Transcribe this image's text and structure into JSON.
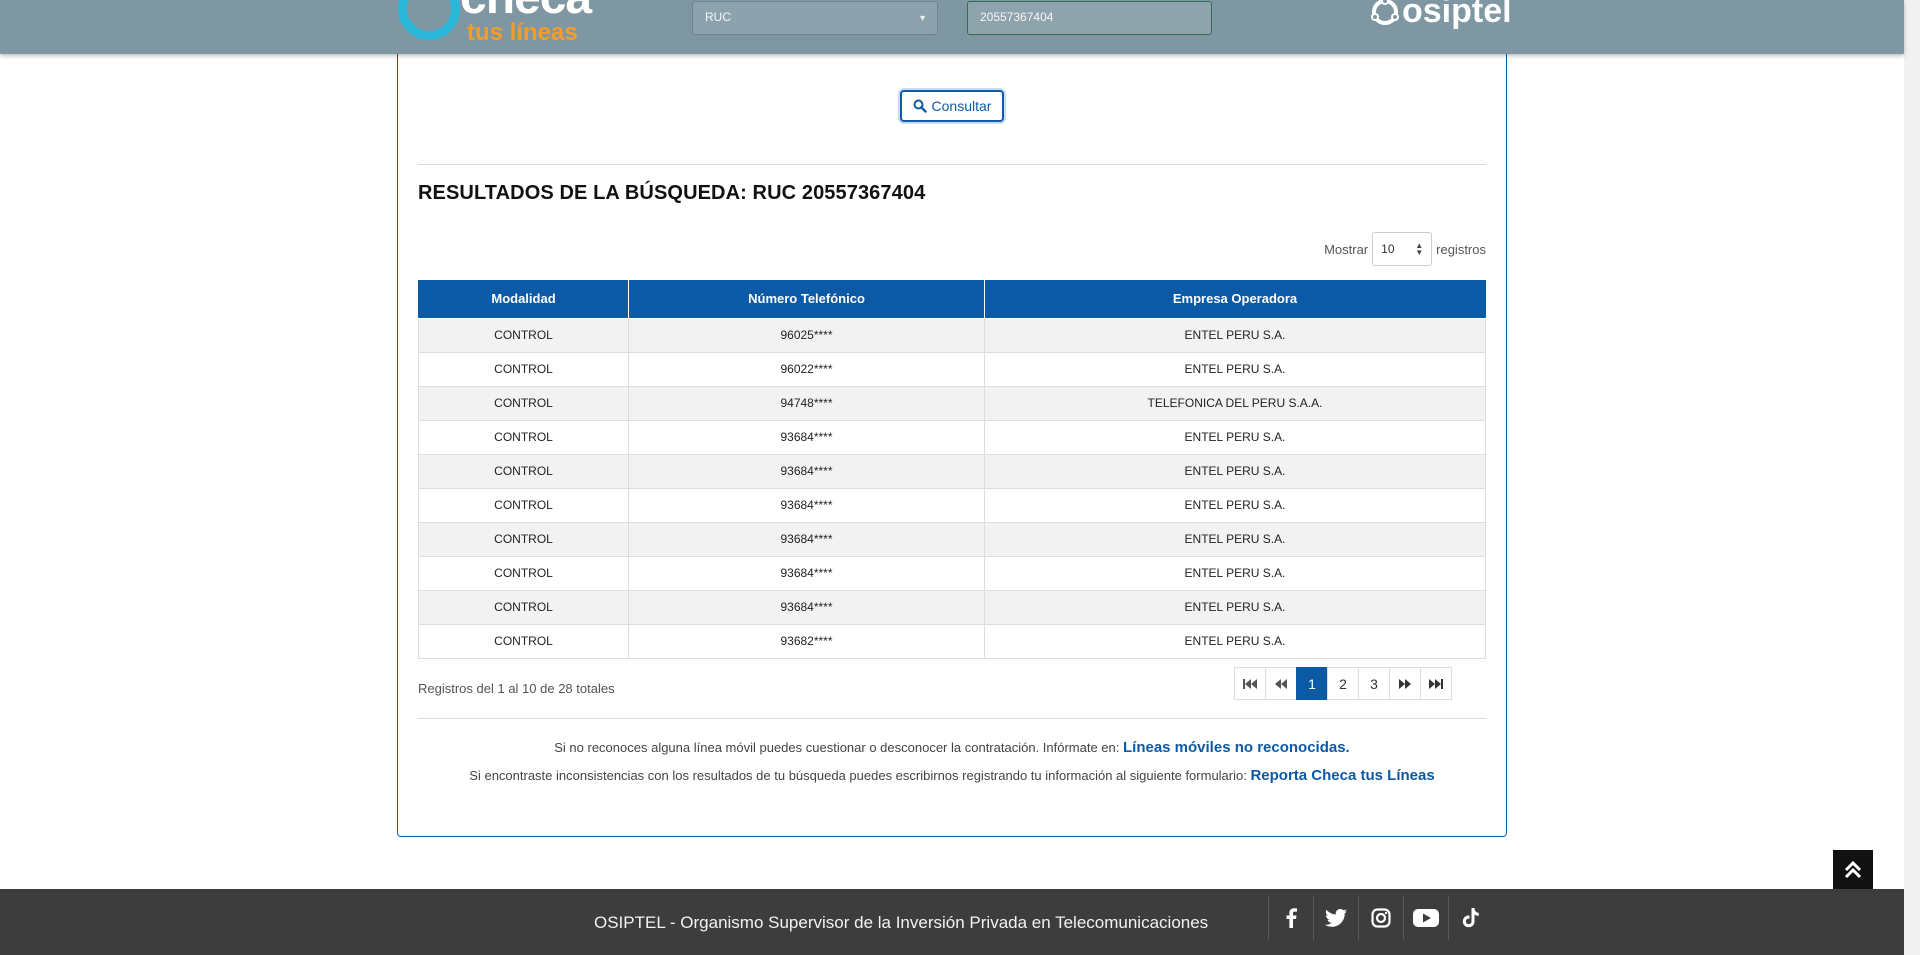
{
  "header": {
    "logo_main": "checa",
    "logo_sub": "tus líneas",
    "doc_type_selected": "RUC",
    "doc_number_value": "20557367404",
    "brand": "osiptel"
  },
  "search": {
    "consultar_label": "Consultar"
  },
  "results": {
    "title": "RESULTADOS DE LA BÚSQUEDA: RUC 20557367404",
    "show_label": "Mostrar",
    "show_value": "10",
    "registros_label": "registros",
    "columns": [
      "Modalidad",
      "Número Telefónico",
      "Empresa Operadora"
    ],
    "rows": [
      [
        "CONTROL",
        "96025****",
        "ENTEL PERU S.A."
      ],
      [
        "CONTROL",
        "96022****",
        "ENTEL PERU S.A."
      ],
      [
        "CONTROL",
        "94748****",
        "TELEFONICA DEL PERU S.A.A."
      ],
      [
        "CONTROL",
        "93684****",
        "ENTEL PERU S.A."
      ],
      [
        "CONTROL",
        "93684****",
        "ENTEL PERU S.A."
      ],
      [
        "CONTROL",
        "93684****",
        "ENTEL PERU S.A."
      ],
      [
        "CONTROL",
        "93684****",
        "ENTEL PERU S.A."
      ],
      [
        "CONTROL",
        "93684****",
        "ENTEL PERU S.A."
      ],
      [
        "CONTROL",
        "93684****",
        "ENTEL PERU S.A."
      ],
      [
        "CONTROL",
        "93682****",
        "ENTEL PERU S.A."
      ]
    ],
    "summary": "Registros del 1 al 10 de 28 totales",
    "pages": [
      "1",
      "2",
      "3"
    ],
    "current_page": "1"
  },
  "notes": {
    "line1_text": "Si no reconoces alguna línea móvil puedes cuestionar o desconocer la contratación. Infórmate en: ",
    "line1_link": "Líneas móviles no reconocidas.",
    "line2_text": "Si encontraste inconsistencias con los resultados de tu búsqueda puedes escribirnos registrando tu información al siguiente formulario: ",
    "line2_link": "Reporta Checa tus Líneas"
  },
  "footer": {
    "text": "OSIPTEL - Organismo Supervisor de la Inversión Privada en Telecomunicaciones",
    "social_icons": [
      "facebook-icon",
      "twitter-icon",
      "instagram-icon",
      "youtube-icon",
      "tiktok-icon"
    ]
  },
  "colors": {
    "header_bg": "#7f97a3",
    "primary": "#0c5aa6",
    "accent_orange": "#f39c2d",
    "accent_cyan": "#2bb7d9",
    "footer_bg": "#3d3d3d"
  }
}
